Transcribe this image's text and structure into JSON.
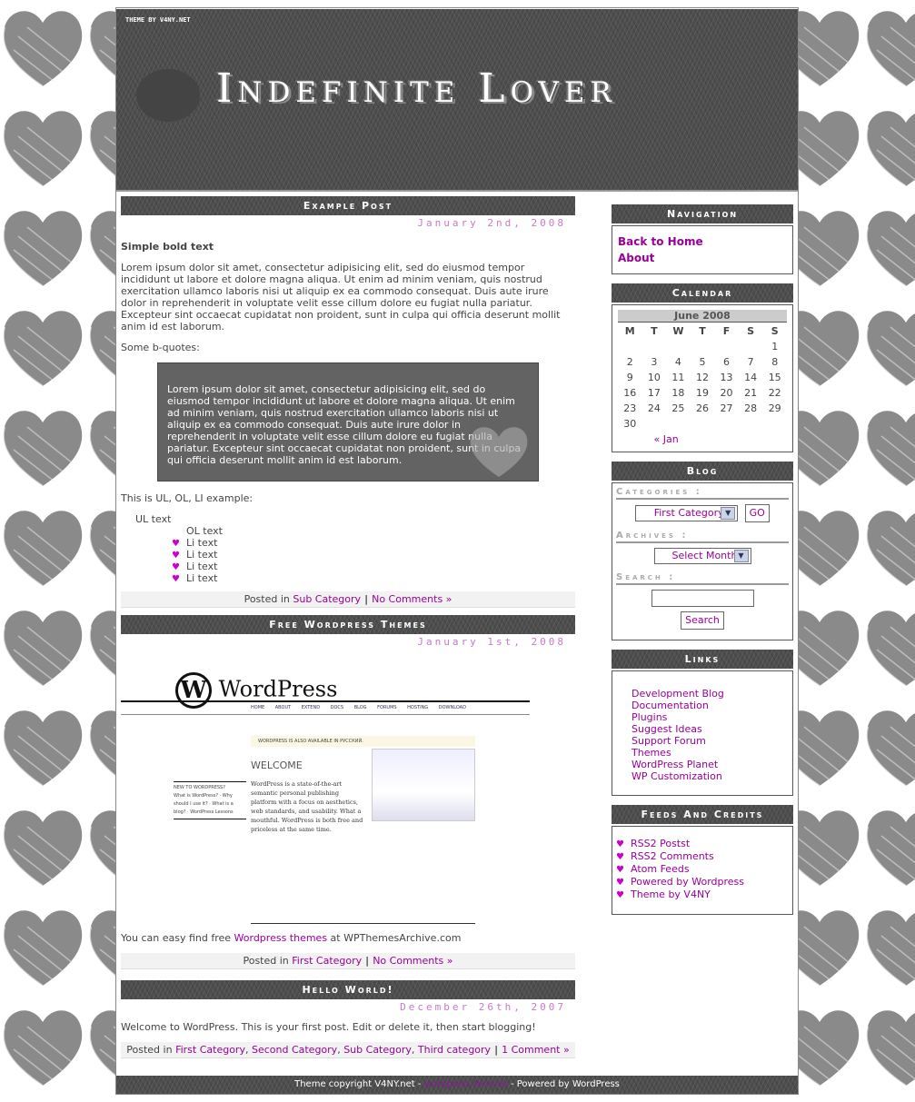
{
  "header": {
    "credit": "THEME BY V4NY.NET",
    "site_title": "Indefinite Lover"
  },
  "colors": {
    "link": "#990099",
    "date": "#c77ac7",
    "bar": "#4e4e4e",
    "heart_bullet": "#cc00cc"
  },
  "posts": [
    {
      "title": "Example Post",
      "date": "January 2nd, 2008",
      "bold": "Simple bold text",
      "para": "Lorem ipsum dolor sit amet, consectetur adipisicing elit, sed do eiusmod tempor incididunt ut labore et dolore magna aliqua. Ut enim ad minim veniam, quis nostrud exercitation ullamco laboris nisi ut aliquip ex ea commodo consequat. Duis aute irure dolor in reprehenderit in voluptate velit esse cillum dolore eu fugiat nulla pariatur. Excepteur sint occaecat cupidatat non proident, sunt in culpa qui officia deserunt mollit anim id est laborum.",
      "bq_intro": "Some b-quotes:",
      "blockquote": "Lorem ipsum dolor sit amet, consectetur adipisicing elit, sed do eiusmod tempor incididunt ut labore et dolore magna aliqua. Ut enim ad minim veniam, quis nostrud exercitation ullamco laboris nisi ut aliquip ex ea commodo consequat. Duis aute irure dolor in reprehenderit in voluptate velit esse cillum dolore eu fugiat nulla pariatur. Excepteur sint occaecat cupidatat non proident, sunt in culpa qui officia deserunt mollit anim id est laborum.",
      "list_intro": "This is UL, OL, LI example:",
      "ul_text": "UL text",
      "ol_text": "OL text",
      "li": [
        "Li text",
        "Li text",
        "Li text",
        "Li text"
      ],
      "meta": {
        "posted_in": "Posted in",
        "categories": [
          "Sub Category"
        ],
        "comments": "No Comments »"
      }
    },
    {
      "title": "Free Wordpress Themes",
      "date": "January 1st, 2008",
      "image": {
        "logo": "WordPress",
        "nav": "HOME ABOUT EXTEND DOCS BLOG FORUMS HOSTING DOWNLOAD",
        "notice": "WORDPRESS IS ALSO AVAILABLE IN РУССКИЙ.",
        "welcome": "WELCOME",
        "text": "WordPress is a state-of-the-art semantic personal publishing platform with a focus on aesthetics, web standards, and usability. What a mouthful. WordPress is both free and priceless at the same time.",
        "left_head": "NEW TO WORDPRESS?",
        "left_items": "What is WordPress? · Why should I use it? · What is a blog? · WordPress Lessons"
      },
      "para_pre": "You can easy find free ",
      "para_link": "Wordpress themes",
      "para_post": " at WPThemesArchive.com",
      "meta": {
        "posted_in": "Posted in",
        "categories": [
          "First Category"
        ],
        "comments": "No Comments »"
      }
    },
    {
      "title": "Hello World!",
      "date": "December 26th, 2007",
      "para": "Welcome to WordPress. This is your first post. Edit or delete it, then start blogging!",
      "meta": {
        "posted_in": "Posted in",
        "categories": [
          "First Category",
          "Second Category",
          "Sub Category",
          "Third category"
        ],
        "comments": "1 Comment »"
      }
    }
  ],
  "sidebar": {
    "navigation": {
      "title": "Navigation",
      "items": [
        "Back to Home",
        "About"
      ]
    },
    "calendar": {
      "title": "Calendar",
      "caption": "June 2008",
      "days": [
        "M",
        "T",
        "W",
        "T",
        "F",
        "S",
        "S"
      ],
      "weeks": [
        [
          "",
          "",
          "",
          "",
          "",
          "",
          "1"
        ],
        [
          "2",
          "3",
          "4",
          "5",
          "6",
          "7",
          "8"
        ],
        [
          "9",
          "10",
          "11",
          "12",
          "13",
          "14",
          "15"
        ],
        [
          "16",
          "17",
          "18",
          "19",
          "20",
          "21",
          "22"
        ],
        [
          "23",
          "24",
          "25",
          "26",
          "27",
          "28",
          "29"
        ],
        [
          "30",
          "",
          "",
          "",
          "",
          "",
          ""
        ]
      ],
      "prev": "« Jan"
    },
    "blog": {
      "title": "Blog",
      "categories_label": "Categories :",
      "category_selected": "First Category",
      "go": "GO",
      "archives_label": "Archives :",
      "archive_selected": "Select Month",
      "search_label": "Search :",
      "search_value": "",
      "search_button": "Search"
    },
    "links": {
      "title": "Links",
      "items": [
        "Development Blog",
        "Documentation",
        "Plugins",
        "Suggest Ideas",
        "Support Forum",
        "Themes",
        "WordPress Planet",
        "WP Customization"
      ]
    },
    "feeds": {
      "title": "Feeds And Credits",
      "items": [
        "RSS2 Postst",
        "RSS2 Comments",
        "Atom Feeds",
        "Powered by Wordpress",
        "Theme by V4NY"
      ]
    }
  },
  "footer": {
    "pre": "Theme copyright V4NY.net - ",
    "link": "wordpress themes",
    "post": " - Powered by WordPress"
  }
}
